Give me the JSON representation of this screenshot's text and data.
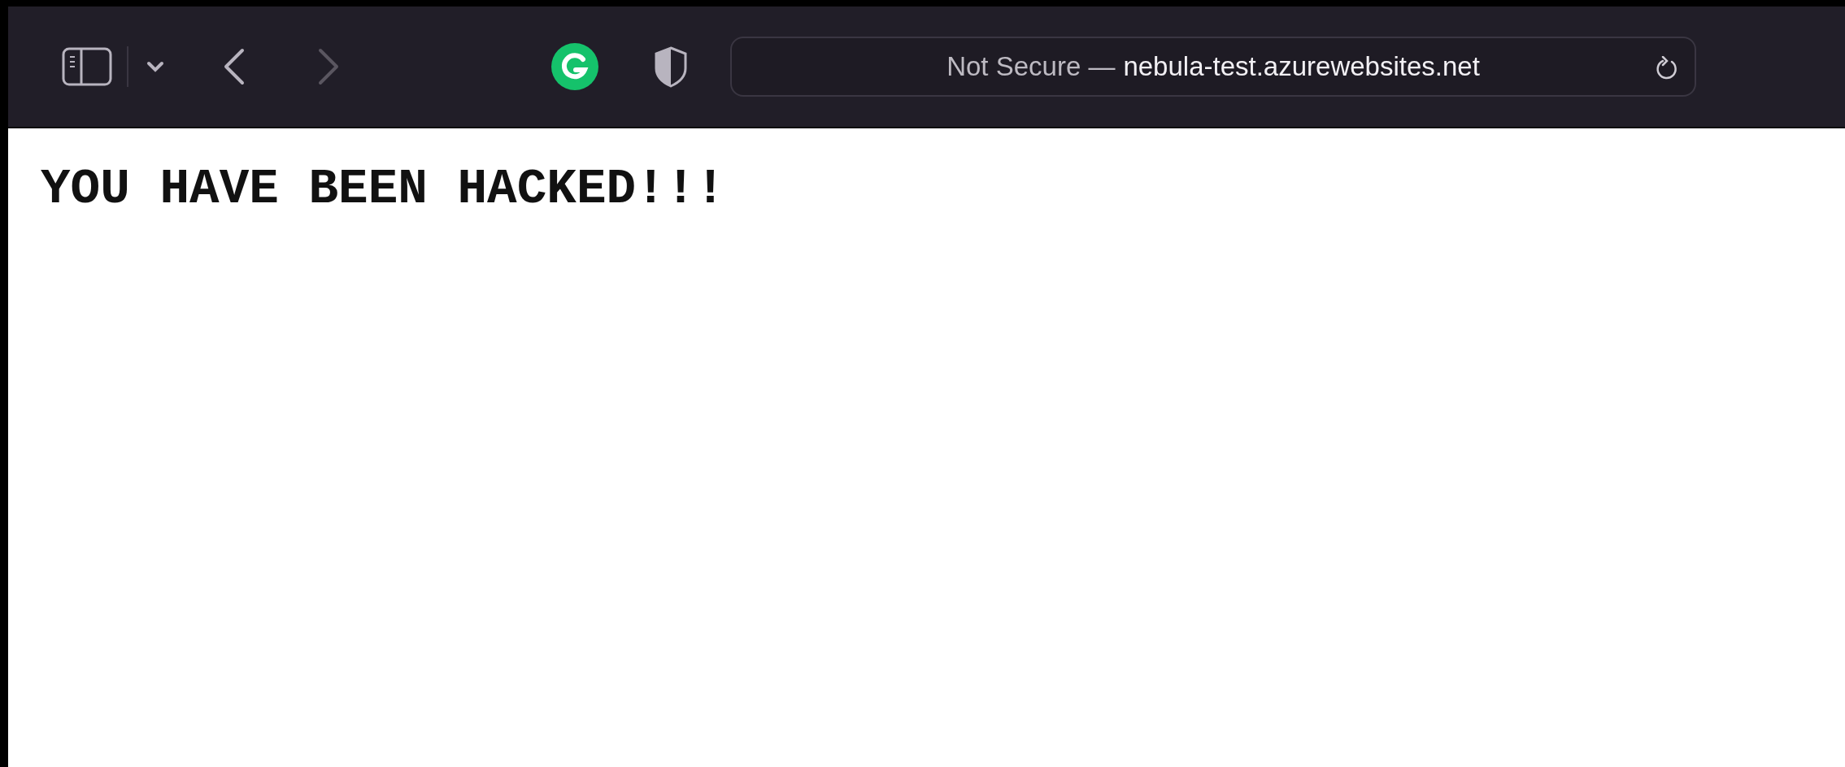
{
  "toolbar": {
    "back": {
      "disabled": false
    },
    "forward": {
      "disabled": true
    },
    "address_bar": {
      "security": "Not Secure —",
      "url": "nebula-test.azurewebsites.net"
    }
  },
  "page": {
    "heading": "YOU HAVE BEEN HACKED!!!"
  }
}
